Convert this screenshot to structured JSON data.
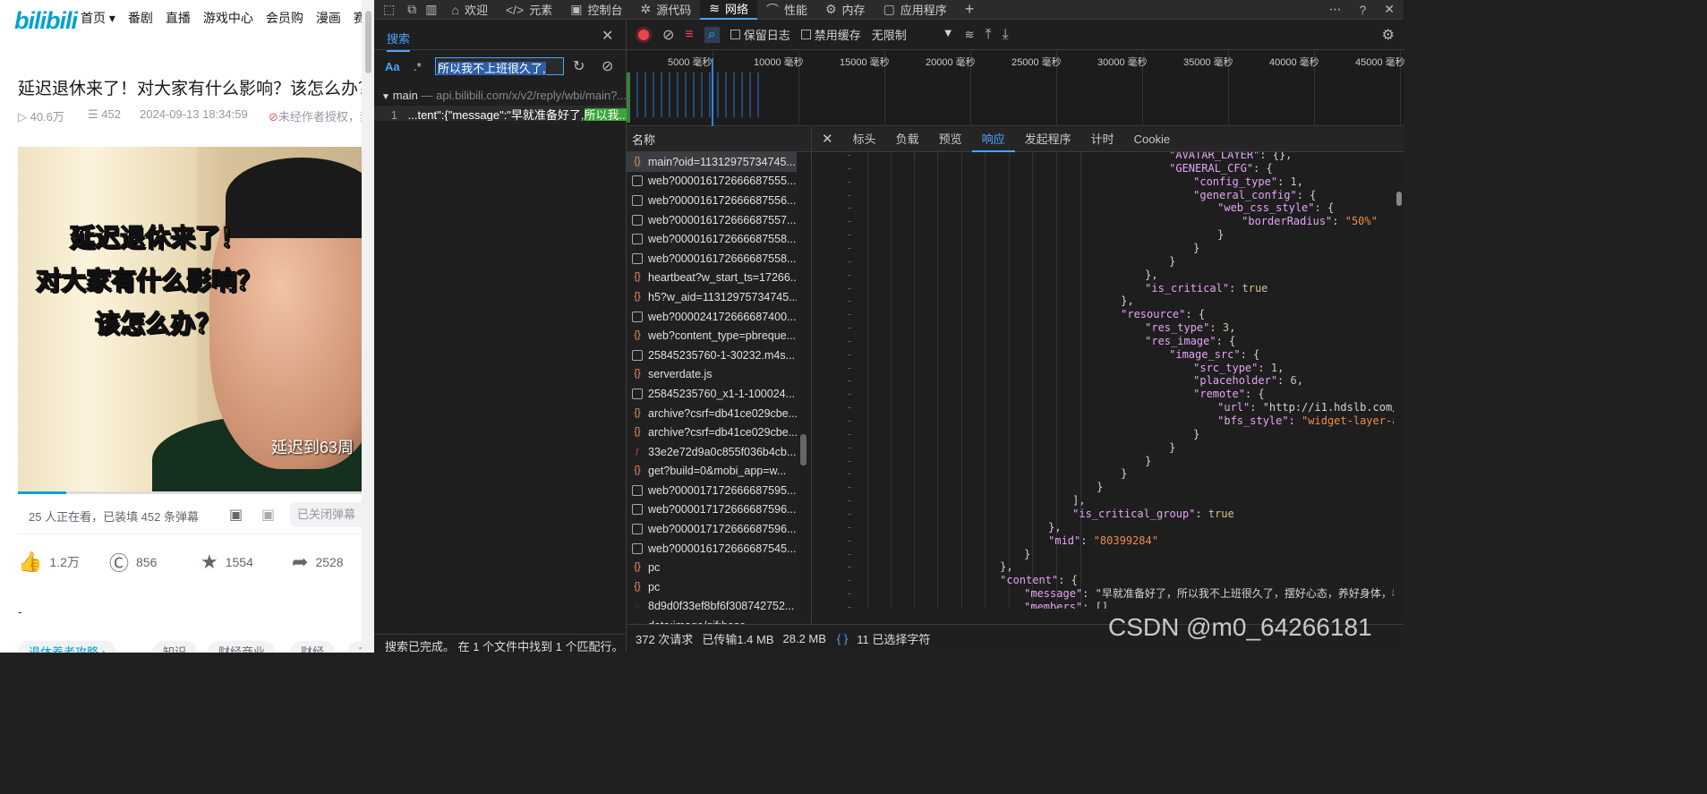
{
  "site": {
    "logo": "bilibili",
    "nav": [
      "首页 ▾",
      "番剧",
      "直播",
      "游戏中心",
      "会员购",
      "漫画",
      "赛事"
    ]
  },
  "video": {
    "title": "延迟退休来了！对大家有什么影响？该怎么办？",
    "views": "40.6万",
    "danmaku_count": "452",
    "date": "2024-09-13 18:34:59",
    "license": "未经作者授权，禁止转载",
    "caption_lines": [
      "延迟退休来了！",
      "对大家有什么影响？",
      "该怎么办？"
    ],
    "subtitle": "延迟到63周",
    "progress": 0.14,
    "watching": "25 人正在看，已装填 452 条弹幕",
    "danmaku_off": "已关闭弹幕",
    "likes": "1.2万",
    "coins": "856",
    "favorites": "1554",
    "shares": "2528",
    "dash": "-",
    "tags": [
      "退休养老攻略 ›",
      "知识",
      "财经商业",
      "财经",
      "工"
    ]
  },
  "devtools": {
    "tabs": [
      "欢迎",
      "元素",
      "控制台",
      "源代码",
      "网络",
      "性能",
      "内存",
      "应用程序"
    ],
    "active_tab": "网络",
    "search": {
      "tab": "搜索",
      "case_label": "Aa",
      "regex_label": ".*",
      "query": "所以我不上班很久了,",
      "result_file": "main",
      "result_url": "— api.bilibili.com/x/v2/reply/wbi/main?...",
      "result_line": "1",
      "result_text": "...tent\":{\"message\":\"早就准备好了,",
      "result_highlight": "所以我...",
      "status": "搜索已完成。 在 1 个文件中找到 1 个匹配行。"
    },
    "toolbar": {
      "preserve_log": "保留日志",
      "disable_cache": "禁用缓存",
      "throttle": "无限制"
    },
    "timeline": [
      "5000 毫秒",
      "10000 毫秒",
      "15000 毫秒",
      "20000 毫秒",
      "25000 毫秒",
      "30000 毫秒",
      "35000 毫秒",
      "40000 毫秒",
      "45000 毫秒"
    ],
    "name_header": "名称",
    "requests": [
      {
        "name": "main?oid=11312975734745...",
        "type": "js"
      },
      {
        "name": "web?000016172666687555...",
        "type": "doc"
      },
      {
        "name": "web?000016172666687556...",
        "type": "doc"
      },
      {
        "name": "web?000016172666687557...",
        "type": "doc"
      },
      {
        "name": "web?000016172666687558...",
        "type": "doc"
      },
      {
        "name": "web?000016172666687558...",
        "type": "doc"
      },
      {
        "name": "heartbeat?w_start_ts=17266...",
        "type": "js"
      },
      {
        "name": "h5?w_aid=11312975734745...",
        "type": "js"
      },
      {
        "name": "web?000024172666687400...",
        "type": "file"
      },
      {
        "name": "web?content_type=pbreque...",
        "type": "js"
      },
      {
        "name": "25845235760-1-30232.m4s...",
        "type": "file"
      },
      {
        "name": "serverdate.js",
        "type": "js"
      },
      {
        "name": "25845235760_x1-1-100024...",
        "type": "file"
      },
      {
        "name": "archive?csrf=db41ce029cbe...",
        "type": "js"
      },
      {
        "name": "archive?csrf=db41ce029cbe...",
        "type": "js"
      },
      {
        "name": "33e2e72d9a0c855f036b4cb...",
        "type": "font"
      },
      {
        "name": "get?build=0&mobi_app=w...",
        "type": "js"
      },
      {
        "name": "web?000017172666687595...",
        "type": "doc"
      },
      {
        "name": "web?000017172666687596...",
        "type": "doc"
      },
      {
        "name": "web?000017172666687596...",
        "type": "doc"
      },
      {
        "name": "web?000016172666687545...",
        "type": "doc"
      },
      {
        "name": "pc",
        "type": "js"
      },
      {
        "name": "pc",
        "type": "js"
      },
      {
        "name": "8d9d0f33ef8bf6f308742752...",
        "type": "img"
      },
      {
        "name": "data:image/gif;base...",
        "type": "img"
      }
    ],
    "detail_tabs": [
      "标头",
      "负载",
      "预览",
      "响应",
      "发起程序",
      "计时",
      "Cookie"
    ],
    "active_detail": "响应",
    "status": {
      "requests": "372 次请求",
      "transferred": "已传输1.4 MB",
      "resources": "28.2 MB",
      "braces": "{ }",
      "selected": "11 已选择字符"
    }
  },
  "watermark": "CSDN @m0_64266181"
}
